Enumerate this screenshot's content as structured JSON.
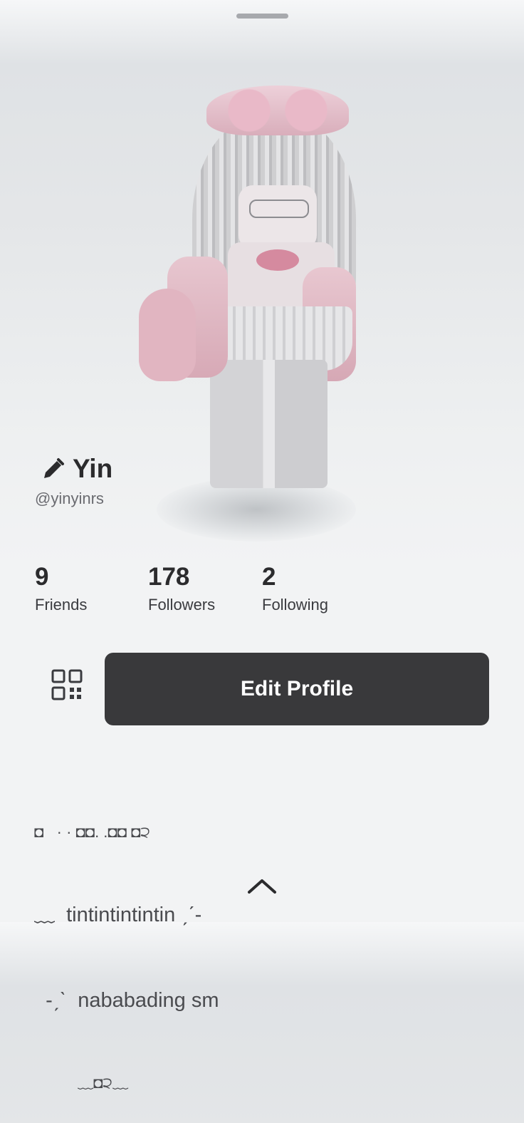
{
  "profile": {
    "display_name": "Yin",
    "username": "@yinyinrs"
  },
  "stats": [
    {
      "value": "9",
      "label": "Friends"
    },
    {
      "value": "178",
      "label": "Followers"
    },
    {
      "value": "2",
      "label": "Following"
    }
  ],
  "actions": {
    "edit_profile_label": "Edit Profile"
  },
  "bio": {
    "line1": "◘   · · ◘◘. .◘◘ ◘੨",
    "line2": "﹏  tintintintintin ˏˊ-",
    "line3": "  -ˏˋ  nababading sm",
    "line4": "          ﹏◘੨﹏"
  },
  "icons": {
    "edit": "pencil-icon",
    "qr": "qr-code-icon",
    "expand": "chevron-up-icon",
    "drag": "drag-handle"
  },
  "colors": {
    "button_bg": "#39393b",
    "button_text": "#ffffff",
    "text_primary": "#2b2b2d",
    "text_secondary": "#6a6b70"
  }
}
